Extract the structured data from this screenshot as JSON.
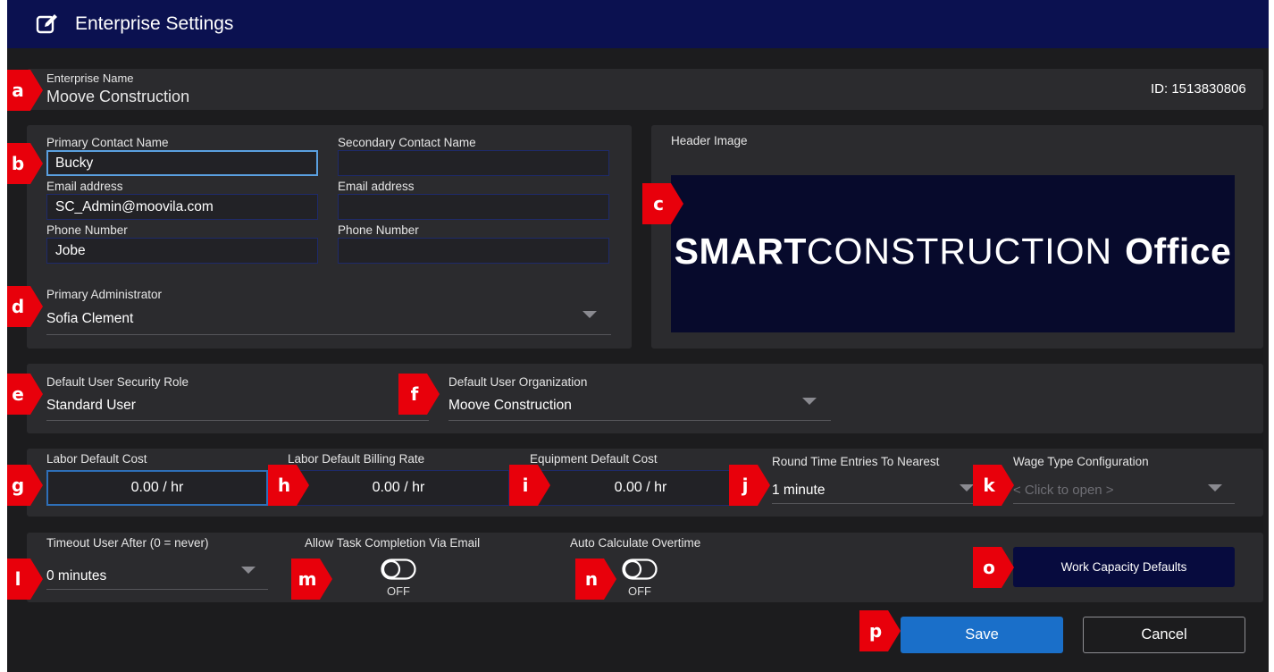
{
  "window": {
    "title": "Enterprise Settings",
    "icon": "edit-icon"
  },
  "enterprise": {
    "name_label": "Enterprise Name",
    "name": "Moove Construction",
    "id_text": "ID: 1513830806"
  },
  "contacts": {
    "primary": {
      "name_label": "Primary Contact Name",
      "name": "Bucky",
      "email_label": "Email address",
      "email": "SC_Admin@moovila.com",
      "phone_label": "Phone Number",
      "phone": "Jobe"
    },
    "secondary": {
      "name_label": "Secondary Contact Name",
      "name": "",
      "email_label": "Email address",
      "email": "",
      "phone_label": "Phone Number",
      "phone": ""
    },
    "admin_label": "Primary Administrator",
    "admin": "Sofia Clement"
  },
  "header_image": {
    "label": "Header Image",
    "logo_bold": "SMART",
    "logo_thin": "CONSTRUCTION",
    "logo_office": "Office"
  },
  "defaults": {
    "security_role_label": "Default User Security Role",
    "security_role": "Standard User",
    "organization_label": "Default User Organization",
    "organization": "Moove Construction"
  },
  "costs": {
    "labor_cost_label": "Labor Default Cost",
    "labor_cost": "0.00 / hr",
    "labor_billing_label": "Labor Default Billing Rate",
    "labor_billing": "0.00 / hr",
    "equipment_cost_label": "Equipment Default Cost",
    "equipment_cost": "0.00 / hr",
    "round_label": "Round Time Entries To Nearest",
    "round": "1 minute",
    "wage_label": "Wage Type Configuration",
    "wage_placeholder": "< Click to open >"
  },
  "misc": {
    "timeout_label": "Timeout User After (0 = never)",
    "timeout": "0 minutes",
    "task_email_label": "Allow Task Completion Via Email",
    "task_email_state": "OFF",
    "overtime_label": "Auto Calculate Overtime",
    "overtime_state": "OFF",
    "work_capacity_button": "Work Capacity Defaults"
  },
  "actions": {
    "save": "Save",
    "cancel": "Cancel"
  },
  "badges": [
    "a",
    "b",
    "c",
    "d",
    "e",
    "f",
    "g",
    "h",
    "i",
    "j",
    "k",
    "l",
    "m",
    "n",
    "o",
    "p"
  ],
  "colors": {
    "titlebar": "#0b1150",
    "panel": "#2b2b2e",
    "background": "#1c1c1e",
    "save": "#1a6fc9",
    "badge": "#e8000b",
    "work_button": "#070b3e"
  }
}
